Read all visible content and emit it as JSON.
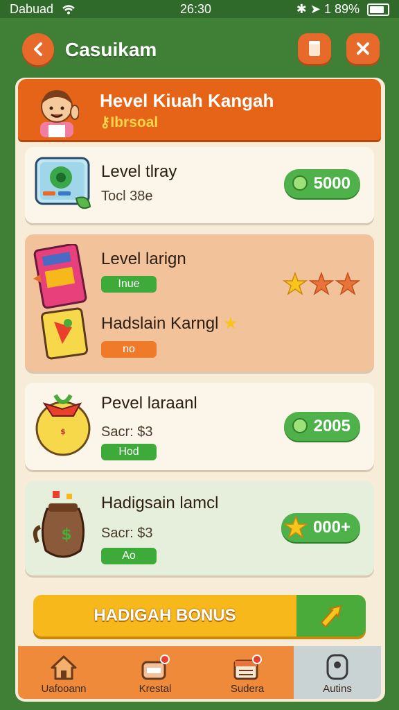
{
  "status": {
    "carrier": "Dabuad",
    "time": "26:30",
    "battery": "1 89%"
  },
  "header": {
    "title": "Casuikam"
  },
  "banner": {
    "title": "Hevel Kiuah Kangah",
    "subtitle": "Ibrsoal"
  },
  "items": [
    {
      "title": "Level tlray",
      "sub": "Tocl 38e",
      "price": "5000"
    },
    {
      "title": "Level larign",
      "tag": "Inue",
      "rating": 1,
      "rating_max": 3
    },
    {
      "title": "Hadslain Karngl",
      "tag": "no"
    },
    {
      "title": "Pevel laraanl",
      "sub": "Sacr: $3",
      "tag": "Hod",
      "price": "2005"
    },
    {
      "title": "Hadigsain lamcl",
      "sub": "Sacr: $3",
      "tag": "Ao",
      "price": "000+"
    }
  ],
  "bonus": {
    "label": "HADIGAH BONUS"
  },
  "nav": [
    {
      "label": "Uafooann",
      "icon": "home-icon"
    },
    {
      "label": "Krestal",
      "icon": "shop-icon"
    },
    {
      "label": "Sudera",
      "icon": "calendar-icon"
    },
    {
      "label": "Autins",
      "icon": "profile-icon"
    }
  ],
  "colors": {
    "accent": "#e66418",
    "green": "#4eb14a",
    "background": "#3f7f36",
    "bonus": "#f7b81c"
  }
}
